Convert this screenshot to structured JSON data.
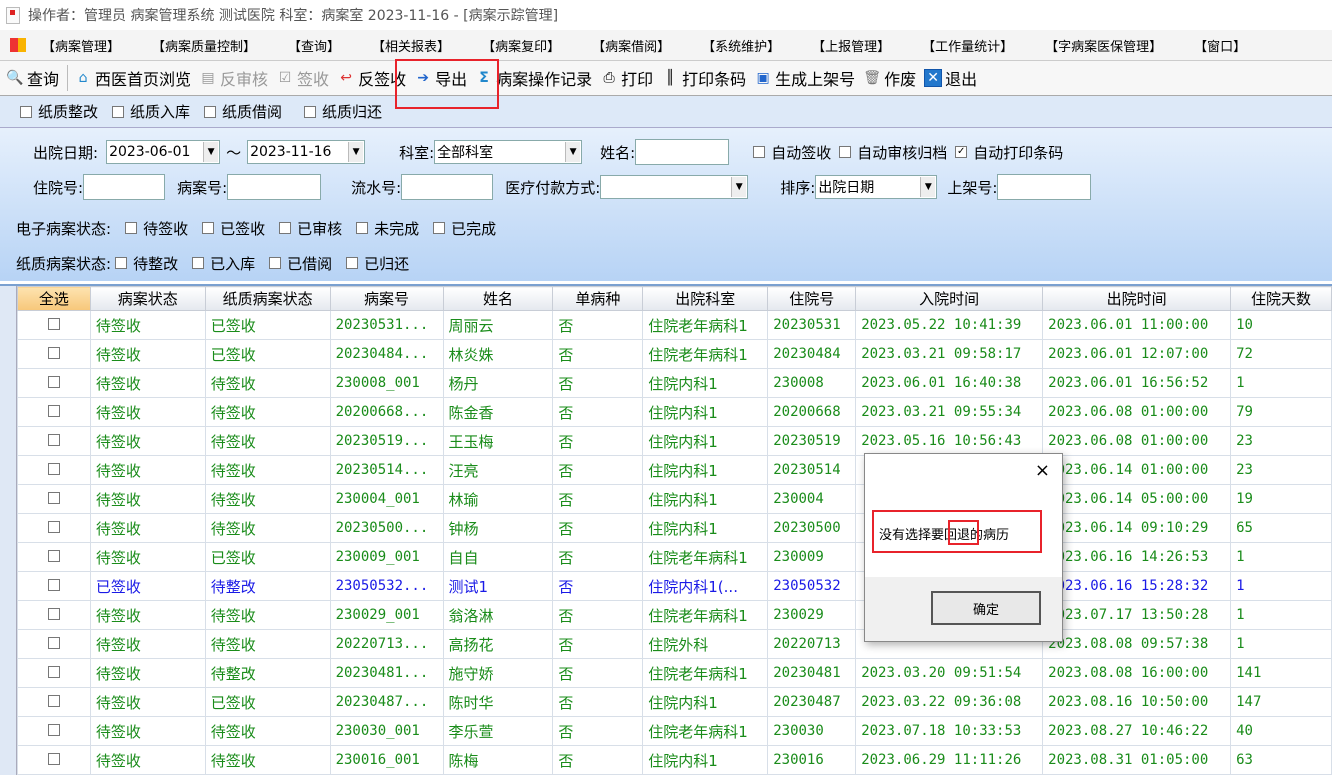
{
  "title": "操作者：管理员  病案管理系统  测试医院  科室：病案室  2023-11-16 - [病案示踪管理]",
  "menu": [
    "【病案管理】",
    "【病案质量控制】",
    "【查询】",
    "【相关报表】",
    "【病案复印】",
    "【病案借阅】",
    "【系统维护】",
    "【上报管理】",
    "【工作量统计】",
    "【字病案医保管理】",
    "【窗口】"
  ],
  "toolbar": {
    "query": "查询",
    "browse": "西医首页浏览",
    "unaudit": "反审核",
    "sign": "签收",
    "unsign": "反签收",
    "export": "导出",
    "oplog": "病案操作记录",
    "print": "打印",
    "barcode": "打印条码",
    "shelf": "生成上架号",
    "void": "作废",
    "exit": "退出"
  },
  "paper_actions": [
    "纸质整改",
    "纸质入库",
    "纸质借阅",
    "纸质归还"
  ],
  "filters": {
    "discharge_label": "出院日期:",
    "date_from": "2023-06-01",
    "tilde": "～",
    "date_to": "2023-11-16",
    "dept_label": "科室:",
    "dept": "全部科室",
    "name_label": "姓名:",
    "auto_sign": "自动签收",
    "auto_audit": "自动审核归档",
    "auto_print": "自动打印条码",
    "inpatient_label": "住院号:",
    "record_label": "病案号:",
    "serial_label": "流水号:",
    "payment_label": "医疗付款方式:",
    "sort_label": "排序:",
    "sort": "出院日期",
    "shelf_label": "上架号:",
    "e_status_label": "电子病案状态:",
    "e_status": [
      "待签收",
      "已签收",
      "已审核",
      "未完成",
      "已完成"
    ],
    "p_status_label": "纸质病案状态:",
    "p_status": [
      "待整改",
      "已入库",
      "已借阅",
      "已归还"
    ]
  },
  "columns": [
    "全选",
    "病案状态",
    "纸质病案状态",
    "病案号",
    "姓名",
    "单病种",
    "出院科室",
    "住院号",
    "入院时间",
    "出院时间",
    "住院天数"
  ],
  "rows": [
    [
      "待签收",
      "已签收",
      "20230531...",
      "周丽云",
      "否",
      "住院老年病科1",
      "20230531",
      "2023.05.22 10:41:39",
      "2023.06.01 11:00:00",
      "10"
    ],
    [
      "待签收",
      "已签收",
      "20230484...",
      "林炎姝",
      "否",
      "住院老年病科1",
      "20230484",
      "2023.03.21 09:58:17",
      "2023.06.01 12:07:00",
      "72"
    ],
    [
      "待签收",
      "待签收",
      "230008_001",
      "杨丹",
      "否",
      "住院内科1",
      "230008",
      "2023.06.01 16:40:38",
      "2023.06.01 16:56:52",
      "1"
    ],
    [
      "待签收",
      "待签收",
      "20200668...",
      "陈金香",
      "否",
      "住院内科1",
      "20200668",
      "2023.03.21 09:55:34",
      "2023.06.08 01:00:00",
      "79"
    ],
    [
      "待签收",
      "待签收",
      "20230519...",
      "王玉梅",
      "否",
      "住院内科1",
      "20230519",
      "2023.05.16 10:56:43",
      "2023.06.08 01:00:00",
      "23"
    ],
    [
      "待签收",
      "待签收",
      "20230514...",
      "汪亮",
      "否",
      "住院内科1",
      "20230514",
      "",
      "2023.06.14 01:00:00",
      "23"
    ],
    [
      "待签收",
      "待签收",
      "230004_001",
      "林瑜",
      "否",
      "住院内科1",
      "230004",
      "",
      "2023.06.14 05:00:00",
      "19"
    ],
    [
      "待签收",
      "待签收",
      "20230500...",
      "钟杨",
      "否",
      "住院内科1",
      "20230500",
      "",
      "2023.06.14 09:10:29",
      "65"
    ],
    [
      "待签收",
      "已签收",
      "230009_001",
      "自自",
      "否",
      "住院老年病科1",
      "230009",
      "",
      "2023.06.16 14:26:53",
      "1"
    ],
    [
      "已签收",
      "待整改",
      "23050532...",
      "测试1",
      "否",
      "住院内科1(...",
      "23050532",
      "",
      "2023.06.16 15:28:32",
      "1"
    ],
    [
      "待签收",
      "待签收",
      "230029_001",
      "翁洛淋",
      "否",
      "住院老年病科1",
      "230029",
      "",
      "2023.07.17 13:50:28",
      "1"
    ],
    [
      "待签收",
      "待签收",
      "20220713...",
      "高扬花",
      "否",
      "住院外科",
      "20220713",
      "",
      "2023.08.08 09:57:38",
      "1"
    ],
    [
      "待签收",
      "待整改",
      "20230481...",
      "施守娇",
      "否",
      "住院老年病科1",
      "20230481",
      "2023.03.20 09:51:54",
      "2023.08.08 16:00:00",
      "141"
    ],
    [
      "待签收",
      "已签收",
      "20230487...",
      "陈时华",
      "否",
      "住院内科1",
      "20230487",
      "2023.03.22 09:36:08",
      "2023.08.16 10:50:00",
      "147"
    ],
    [
      "待签收",
      "待签收",
      "230030_001",
      "李乐萱",
      "否",
      "住院老年病科1",
      "230030",
      "2023.07.18 10:33:53",
      "2023.08.27 10:46:22",
      "40"
    ],
    [
      "待签收",
      "待签收",
      "230016_001",
      "陈梅",
      "否",
      "住院内科1",
      "230016",
      "2023.06.29 11:11:26",
      "2023.08.31 01:05:00",
      "63"
    ]
  ],
  "blue_row_index": 9,
  "dialog": {
    "message": "没有选择要回退的病历",
    "ok": "确定",
    "close": "×"
  }
}
